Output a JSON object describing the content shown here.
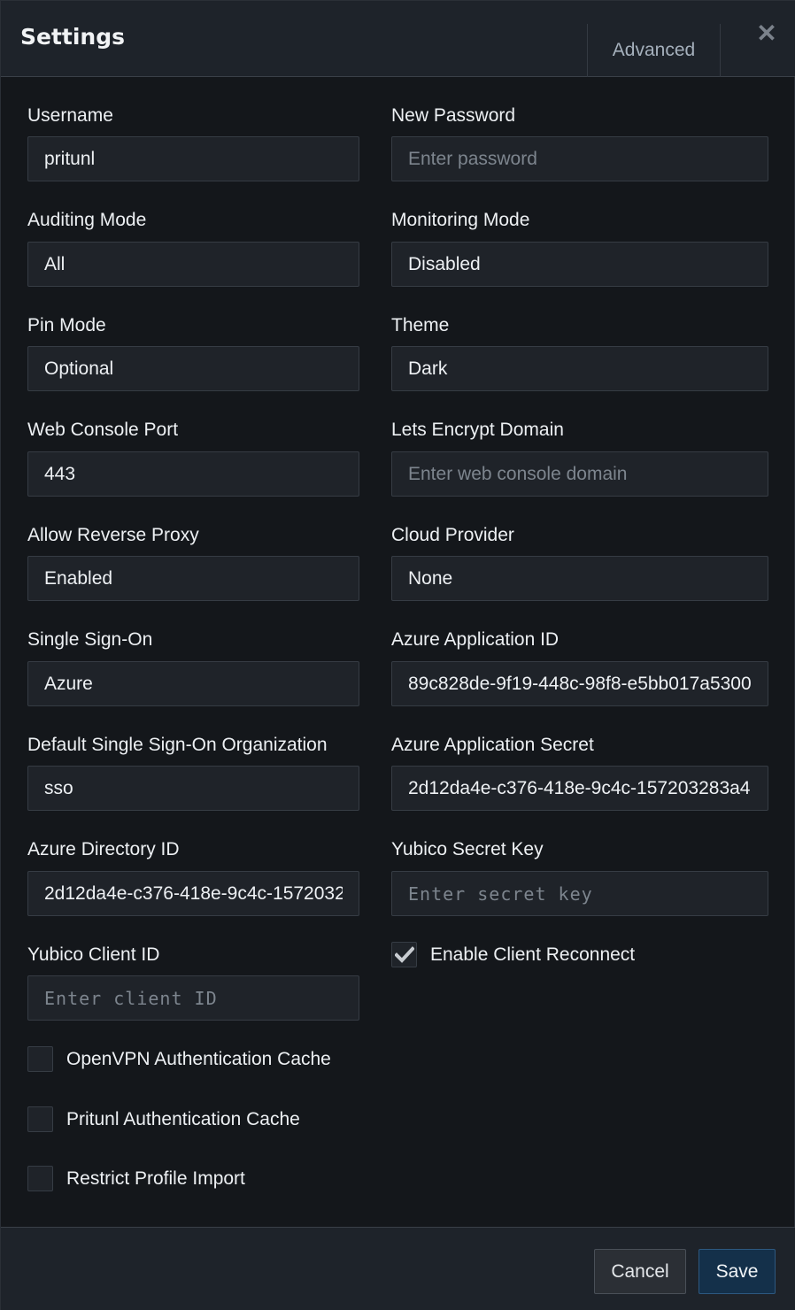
{
  "header": {
    "title": "Settings",
    "advanced_tab": "Advanced",
    "close_icon": "close-icon"
  },
  "fields": {
    "username": {
      "label": "Username",
      "value": "pritunl"
    },
    "new_password": {
      "label": "New Password",
      "placeholder": "Enter password"
    },
    "auditing_mode": {
      "label": "Auditing Mode",
      "value": "All"
    },
    "monitoring_mode": {
      "label": "Monitoring Mode",
      "value": "Disabled"
    },
    "pin_mode": {
      "label": "Pin Mode",
      "value": "Optional"
    },
    "theme": {
      "label": "Theme",
      "value": "Dark"
    },
    "web_console_port": {
      "label": "Web Console Port",
      "value": "443"
    },
    "lets_encrypt_domain": {
      "label": "Lets Encrypt Domain",
      "placeholder": "Enter web console domain"
    },
    "allow_reverse_proxy": {
      "label": "Allow Reverse Proxy",
      "value": "Enabled"
    },
    "cloud_provider": {
      "label": "Cloud Provider",
      "value": "None"
    },
    "single_sign_on": {
      "label": "Single Sign-On",
      "value": "Azure"
    },
    "azure_application_id": {
      "label": "Azure Application ID",
      "value": "89c828de-9f19-448c-98f8-e5bb017a5300"
    },
    "default_sso_org": {
      "label": "Default Single Sign-On Organization",
      "value": "sso"
    },
    "azure_application_secret": {
      "label": "Azure Application Secret",
      "value": "2d12da4e-c376-418e-9c4c-157203283a4"
    },
    "azure_directory_id": {
      "label": "Azure Directory ID",
      "value": "2d12da4e-c376-418e-9c4c-1572032"
    },
    "yubico_secret_key": {
      "label": "Yubico Secret Key",
      "placeholder": "Enter secret key"
    },
    "yubico_client_id": {
      "label": "Yubico Client ID",
      "placeholder": "Enter client ID"
    }
  },
  "checkboxes": {
    "enable_client_reconnect": {
      "label": "Enable Client Reconnect",
      "checked": true
    },
    "openvpn_auth_cache": {
      "label": "OpenVPN Authentication Cache",
      "checked": false
    },
    "pritunl_auth_cache": {
      "label": "Pritunl Authentication Cache",
      "checked": false
    },
    "restrict_profile_import": {
      "label": "Restrict Profile Import",
      "checked": false
    }
  },
  "footer": {
    "cancel_label": "Cancel",
    "save_label": "Save"
  },
  "colors": {
    "background": "#14171b",
    "header_bg": "#1e232a",
    "field_bg": "#1f2329",
    "save_button_bg": "#14304a"
  }
}
